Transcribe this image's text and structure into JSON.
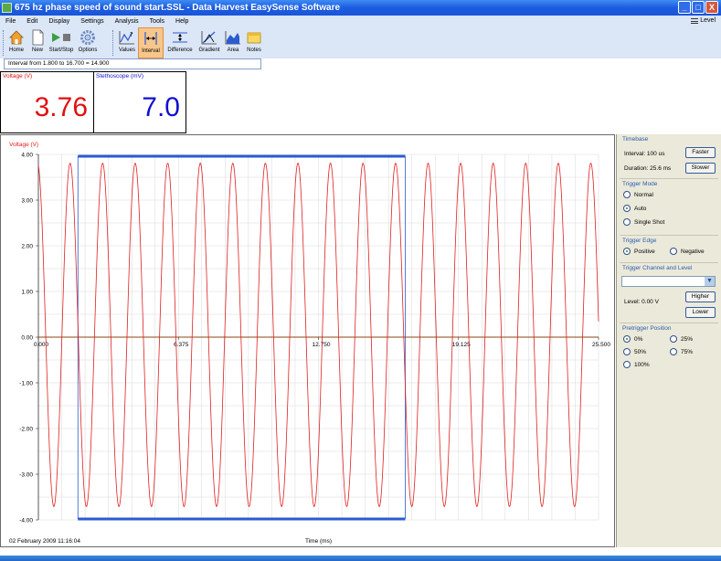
{
  "window": {
    "title": "675 hz phase speed of sound start.SSL - Data Harvest EasySense Software",
    "buttons": {
      "minimize": "_",
      "maximize": "□",
      "close": "X"
    }
  },
  "menu": {
    "items": [
      "File",
      "Edit",
      "Display",
      "Settings",
      "Analysis",
      "Tools",
      "Help"
    ],
    "level": "Level"
  },
  "toolbar": {
    "home": "Home",
    "new": "New",
    "start_stop": "Start/Stop",
    "options": "Options",
    "values": "Values",
    "interval": "Interval",
    "difference": "Difference",
    "gradient": "Gradient",
    "area": "Area",
    "notes": "Notes"
  },
  "status": {
    "interval_text": "Interval from 1.800 to 16.700 = 14.900"
  },
  "meters": [
    {
      "label": "Voltage (V)",
      "value": "3.76",
      "color": "#e01010"
    },
    {
      "label": "Stethoscope (mV)",
      "value": "7.0",
      "color": "#1010d0"
    }
  ],
  "graph": {
    "ylabel": "Voltage (V)",
    "xlabel": "Time (ms)",
    "timestamp": "02 February 2009  11:16:04",
    "y_ticks": [
      "4.00",
      "3.00",
      "2.00",
      "1.00",
      "0.00",
      "-1.00",
      "-2.00",
      "-3.00",
      "-4.00"
    ],
    "x_ticks": [
      "0.000",
      "6.375",
      "12.750",
      "19.125",
      "25.500"
    ],
    "trace_color": "#e02020",
    "axis_color": "#8b4513",
    "interval_color": "#2a5bd0"
  },
  "chart_data": {
    "type": "line",
    "title": "",
    "xlabel": "Time (ms)",
    "ylabel": "Voltage (V)",
    "xlim": [
      0,
      25.5
    ],
    "ylim": [
      -4,
      4
    ],
    "grid": true,
    "series": [
      {
        "name": "Voltage (V)",
        "frequency_hz": 675,
        "amplitude": 3.76,
        "offset": 0.05,
        "x_range": [
          0,
          25.5
        ],
        "x_step": 0.1
      }
    ],
    "interval": {
      "start": 1.8,
      "end": 16.7,
      "width": 14.9
    }
  },
  "rpanel": {
    "timebase": {
      "title": "Timebase",
      "interval": "Interval: 100 us",
      "duration": "Duration: 25.6 ms",
      "faster": "Faster",
      "slower": "Slower"
    },
    "trigger_mode": {
      "title": "Trigger Mode",
      "options": [
        "Normal",
        "Auto",
        "Single Shot"
      ],
      "selected": "Auto"
    },
    "trigger_edge": {
      "title": "Trigger Edge",
      "options": [
        "Positive",
        "Negative"
      ],
      "selected": "Positive"
    },
    "trigger_channel": {
      "title": "Trigger Channel and Level",
      "selected": "",
      "level": "Level: 0.00 V",
      "higher": "Higher",
      "lower": "Lower"
    },
    "pretrigger": {
      "title": "Pretrigger Position",
      "options": [
        "0%",
        "25%",
        "50%",
        "75%",
        "100%"
      ],
      "selected": "0%"
    }
  }
}
